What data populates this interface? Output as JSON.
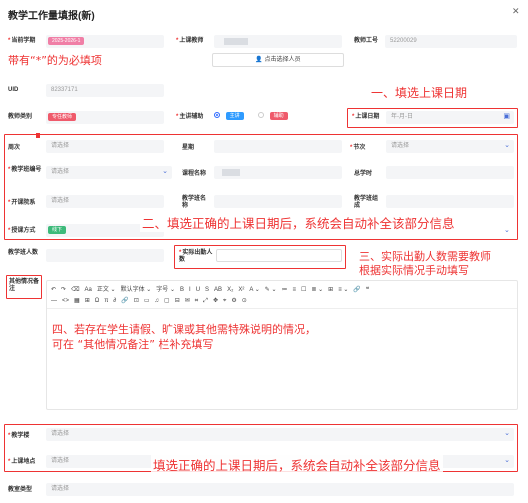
{
  "title": "教学工作量填报(新)",
  "fields": {
    "term_label": "当前学期",
    "term_value": "2025-2026-1",
    "teacher_label": "上课教师",
    "teacher_id_label": "教师工号",
    "teacher_id_value": "52200029",
    "select_person": "点击选择人员",
    "uid_label": "UID",
    "uid_value": "82337171",
    "category_label": "教师类别",
    "category_value": "专任教师",
    "assist_label": "主讲辅助",
    "assist_main": "主讲",
    "assist_aux": "辅助",
    "date_label": "上课日期",
    "date_placeholder": "年-月-日",
    "week_label": "周次",
    "weekday_label": "星期",
    "period_label": "节次",
    "class_no_label": "教学班编号",
    "course_label": "课程名称",
    "total_hours_label": "总学时",
    "college_label": "开课院系",
    "class_name_label": "教学班名称",
    "class_comp_label": "教学班组成",
    "mode_label": "授课方式",
    "mode_value": "线下",
    "class_count_label": "教学班人数",
    "actual_label": "实际出勤人数",
    "remarks_label": "其他情况备注",
    "building_label": "教学楼",
    "location_label": "上课地点",
    "room_type_label": "教室类型",
    "placeholder": "请选择"
  },
  "editor": {
    "row1": [
      "↶",
      "↷",
      "⌫",
      "Aa",
      "正文 ⌄",
      "默认字体 ⌄",
      "字号 ⌄",
      "B",
      "I",
      "U",
      "S",
      "AB",
      "X₂",
      "X²",
      "A ⌄",
      "✎ ⌄",
      "≔",
      "≡",
      "☐",
      "≣ ⌄",
      "⊞",
      "≡ ⌄",
      "🔗",
      "❝"
    ],
    "row2": [
      "—",
      "<>",
      "▦",
      "⊞",
      "Ω",
      "π",
      "∂",
      "🔗",
      "⊡",
      "▭",
      "♫",
      "▢",
      "⊟",
      "✉",
      "⌗",
      "⤢",
      "✥",
      "⌖",
      "⚙",
      "⊙"
    ]
  },
  "annotations": {
    "required": "带有“*”的为必填项",
    "a1": "一、填选上课日期",
    "a2": "二、填选正确的上课日期后，系统会自动补全该部分信息",
    "a3_line1": "三、实际出勤人数需要教师",
    "a3_line2": "根据实际情况手动填写",
    "a4_line1": "四、若存在学生请假、旷课或其他需特殊说明的情况，",
    "a4_line2": "可在 “其他情况备注” 栏补充填写",
    "a5": "填选正确的上课日期后，系统会自动补全该部分信息"
  },
  "colors": {
    "accent": "#2f6bff",
    "red": "#e33333",
    "tag_pink": "#f07fa6",
    "tag_red": "#ef5a6b",
    "tag_green": "#3dba7a"
  }
}
